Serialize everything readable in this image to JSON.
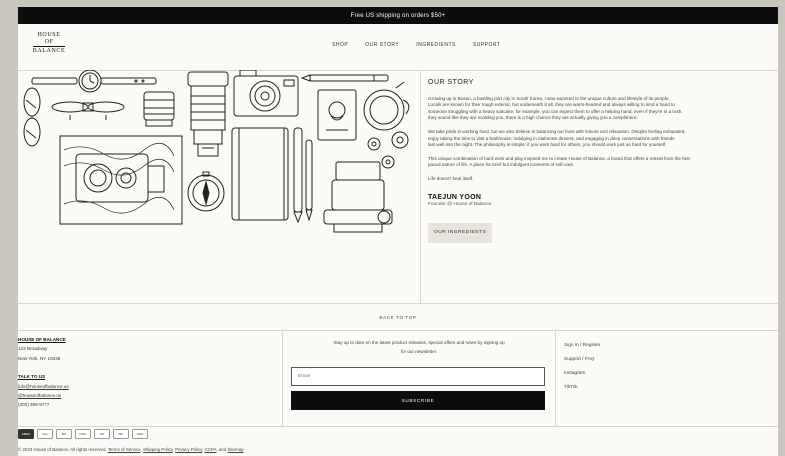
{
  "announcement": "Free US shipping on orders $50+",
  "logo": {
    "line1": "HOUSE",
    "line2": "OF",
    "line3": "BALANCE"
  },
  "nav": [
    "SHOP",
    "OUR STORY",
    "INGREDIENTS",
    "SUPPORT"
  ],
  "story": {
    "title": "OUR STORY",
    "p1": "Growing up in Busan, a bustling port city in South Korea, I was exposed to the unique culture and lifestyle of its people.",
    "p1b": "Locals are known for their tough exterior, but underneath it all, they are warm-hearted and always willing to lend a hand to",
    "p1c": "someone struggling with a heavy suitcase, for example, you can expect them to offer a helping hand, even if they're in a rush.",
    "p1d": "they sound like they are scolding you, there is a high chance they are actually giving you a compliment.",
    "p2": "We take pride in working hard, but we also believe in balancing our lives with leisure and relaxation. Despite feeling exhausted,",
    "p2b": "enjoy taking the time to visit a bathhouse, indulging in elaborate dinners, and engaging in deep conversations with friends",
    "p2c": "last well into the night. The philosophy is simple: if you work hard for others, you should work just as hard for yourself.",
    "p3": "This unique combination of hard work and play inspired me to create House of Balance, a brand that offers a retreat from the fast-",
    "p3b": "paced nature of life. A place for brief but indulgent moments of self-care.",
    "p4": "Life doesn't heal itself.",
    "author": "TAEJUN YOON",
    "role": "Founder @ House of Balance",
    "button": "OUR INGREDIENTS"
  },
  "back_to_top": "BACK TO TOP",
  "footer": {
    "brand": "HOUSE OF BALANCE",
    "address1": "123 Broadway",
    "address2": "New York, NY 10038",
    "talk_heading": "TALK TO US",
    "email": "info@houseofbalance.us",
    "handle": "@houseofbalance.us",
    "phone": "(302) 399-9777",
    "newsletter_text1": "Stay up to date on the latest product releases, special offers and news by signing up",
    "newsletter_text2": "for our newsletter.",
    "email_placeholder": "Email",
    "subscribe": "SUBSCRIBE",
    "links": [
      "Sign in / Register",
      "Support / FAQ",
      "Instagram",
      "TikTok"
    ]
  },
  "payments": [
    "AMEX",
    "Pay",
    "DC",
    "DISC",
    "GP",
    "MC",
    "VISA"
  ],
  "copyright": {
    "prefix": "© 2023 House of Balance. All rights reserved.",
    "terms": "Terms of Service",
    "shipping": "Shipping Policy",
    "privacy": "Privacy Policy",
    "ccpa": "CCPA",
    "and": "and",
    "sitemap": "Sitemap"
  }
}
